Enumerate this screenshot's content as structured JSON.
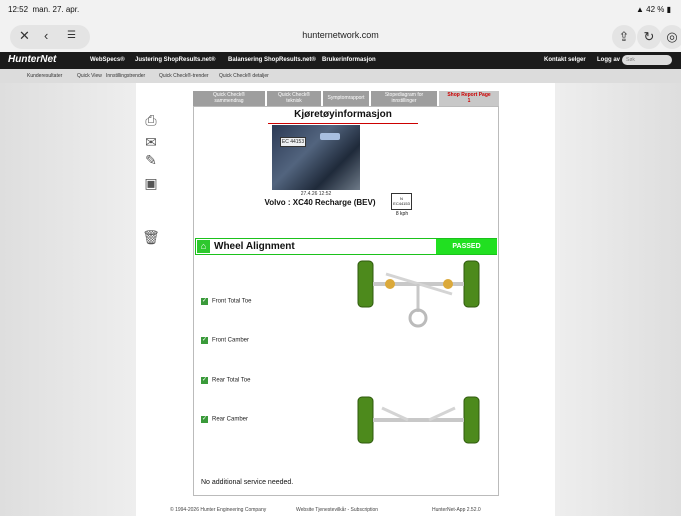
{
  "status": {
    "time": "12:52",
    "date": "man. 27. apr.",
    "battery": "42 %"
  },
  "browser": {
    "url": "hunternetwork.com"
  },
  "nav": {
    "logo": "HunterNet",
    "items": [
      "WebSpecs®",
      "Justering ShopResults.net®",
      "Balansering ShopResults.net®",
      "Brukerinformasjon"
    ],
    "right_items": [
      "Kontakt selger",
      "Logg av"
    ],
    "search_placeholder": "Søk"
  },
  "subnav": [
    "Kunderesultater",
    "Quick View",
    "Innstillingstrender",
    "Quick Check®-trender",
    "Quick Check® detaljer"
  ],
  "tabs": [
    {
      "line1": "Quick Check®",
      "line2": "sammendrag"
    },
    {
      "line1": "Quick Check®",
      "line2": "teknisk"
    },
    {
      "line1": "Symptomrapport",
      "line2": ""
    },
    {
      "line1": "Stopediagram for",
      "line2": "innstillinger"
    },
    {
      "line1": "Shop Report Page",
      "line2": "1"
    }
  ],
  "report": {
    "title": "Kjøretøyinformasjon",
    "photo_plate": "EC 44153",
    "datetime": "27.4.26 12:52",
    "vehicle": "Volvo : XC40 Recharge (BEV)",
    "plate_country": "N",
    "plate": "EC44153",
    "speed": "8 kph"
  },
  "alignment": {
    "title": "Wheel Alignment",
    "status": "PASSED",
    "checks": [
      "Front Total Toe",
      "Front Camber",
      "Rear Total Toe",
      "Rear Camber"
    ],
    "note": "No additional service needed."
  },
  "footer": {
    "copyright": "© 1994-2026 Hunter Engineering Company",
    "links": "Website Tjenestevilkår - Subscription",
    "version": "HunterNet-App 2.52.0"
  },
  "colors": {
    "passed": "#21e021",
    "accent_red": "#cc0000",
    "nav_bg": "#1b1b1b"
  }
}
